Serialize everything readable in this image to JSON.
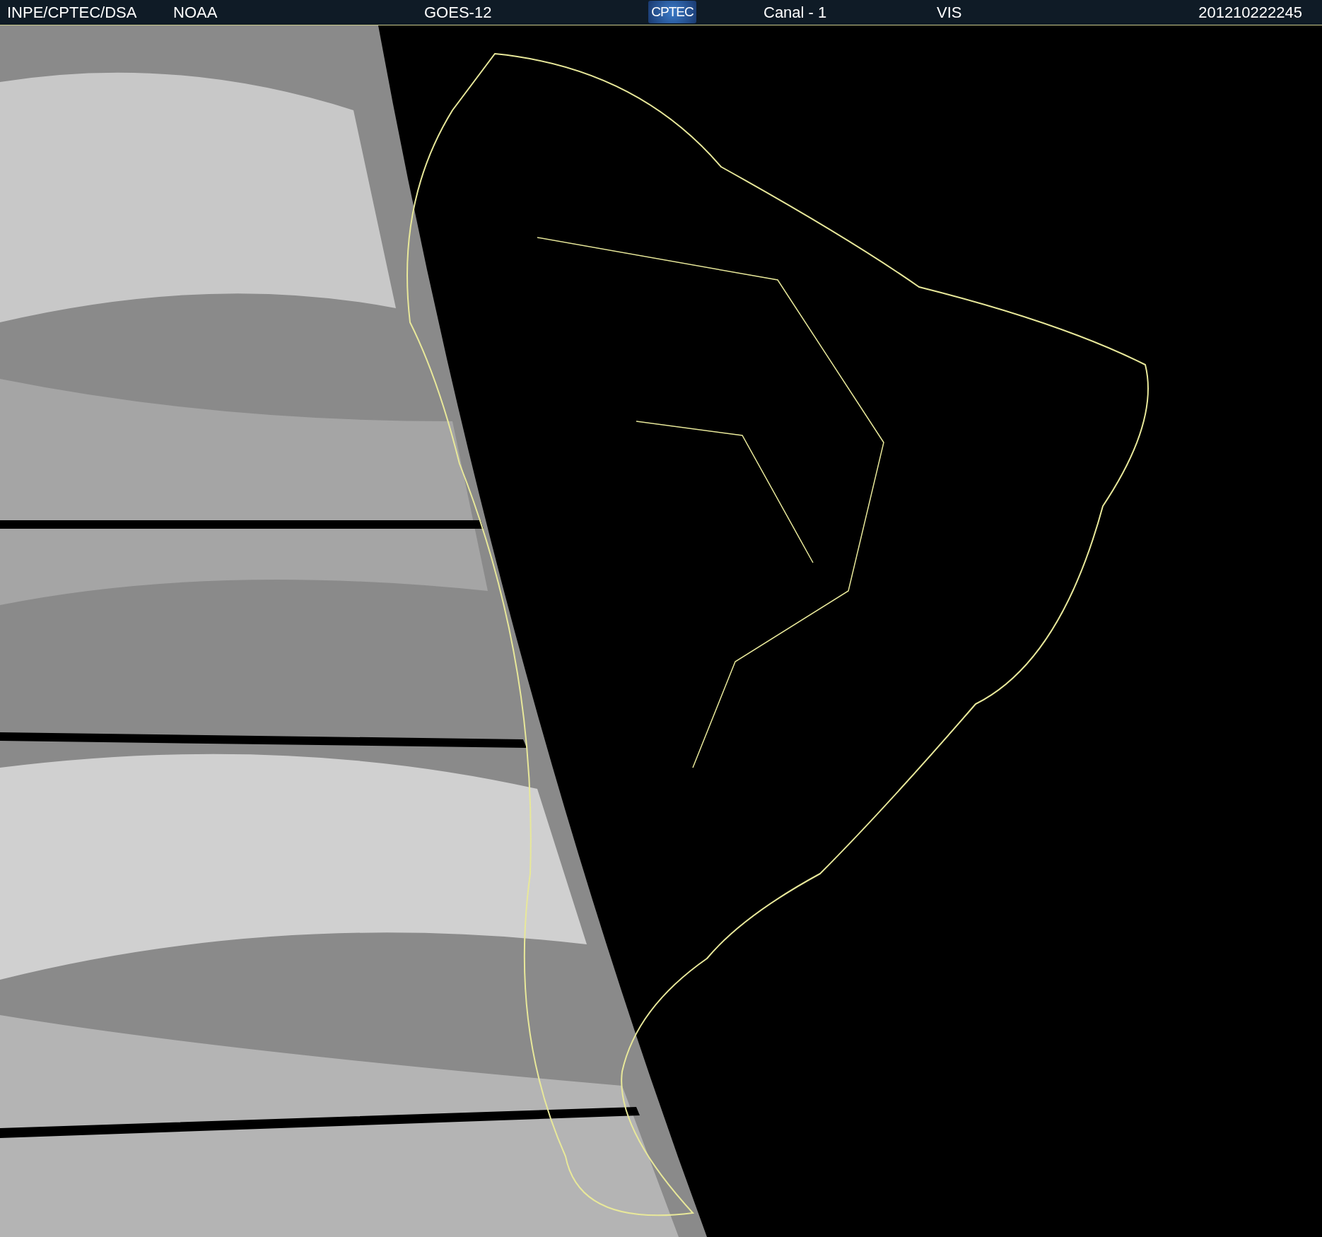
{
  "header": {
    "items": [
      {
        "kind": "text",
        "text": "INPE/CPTEC/DSA"
      },
      {
        "kind": "text",
        "text": "NOAA"
      },
      {
        "kind": "text",
        "text": "GOES-12"
      },
      {
        "kind": "logo",
        "text": "CPTEC"
      },
      {
        "kind": "text",
        "text": "Canal - 1"
      },
      {
        "kind": "text",
        "text": "VIS"
      },
      {
        "kind": "text",
        "text": "201210222245"
      }
    ]
  }
}
